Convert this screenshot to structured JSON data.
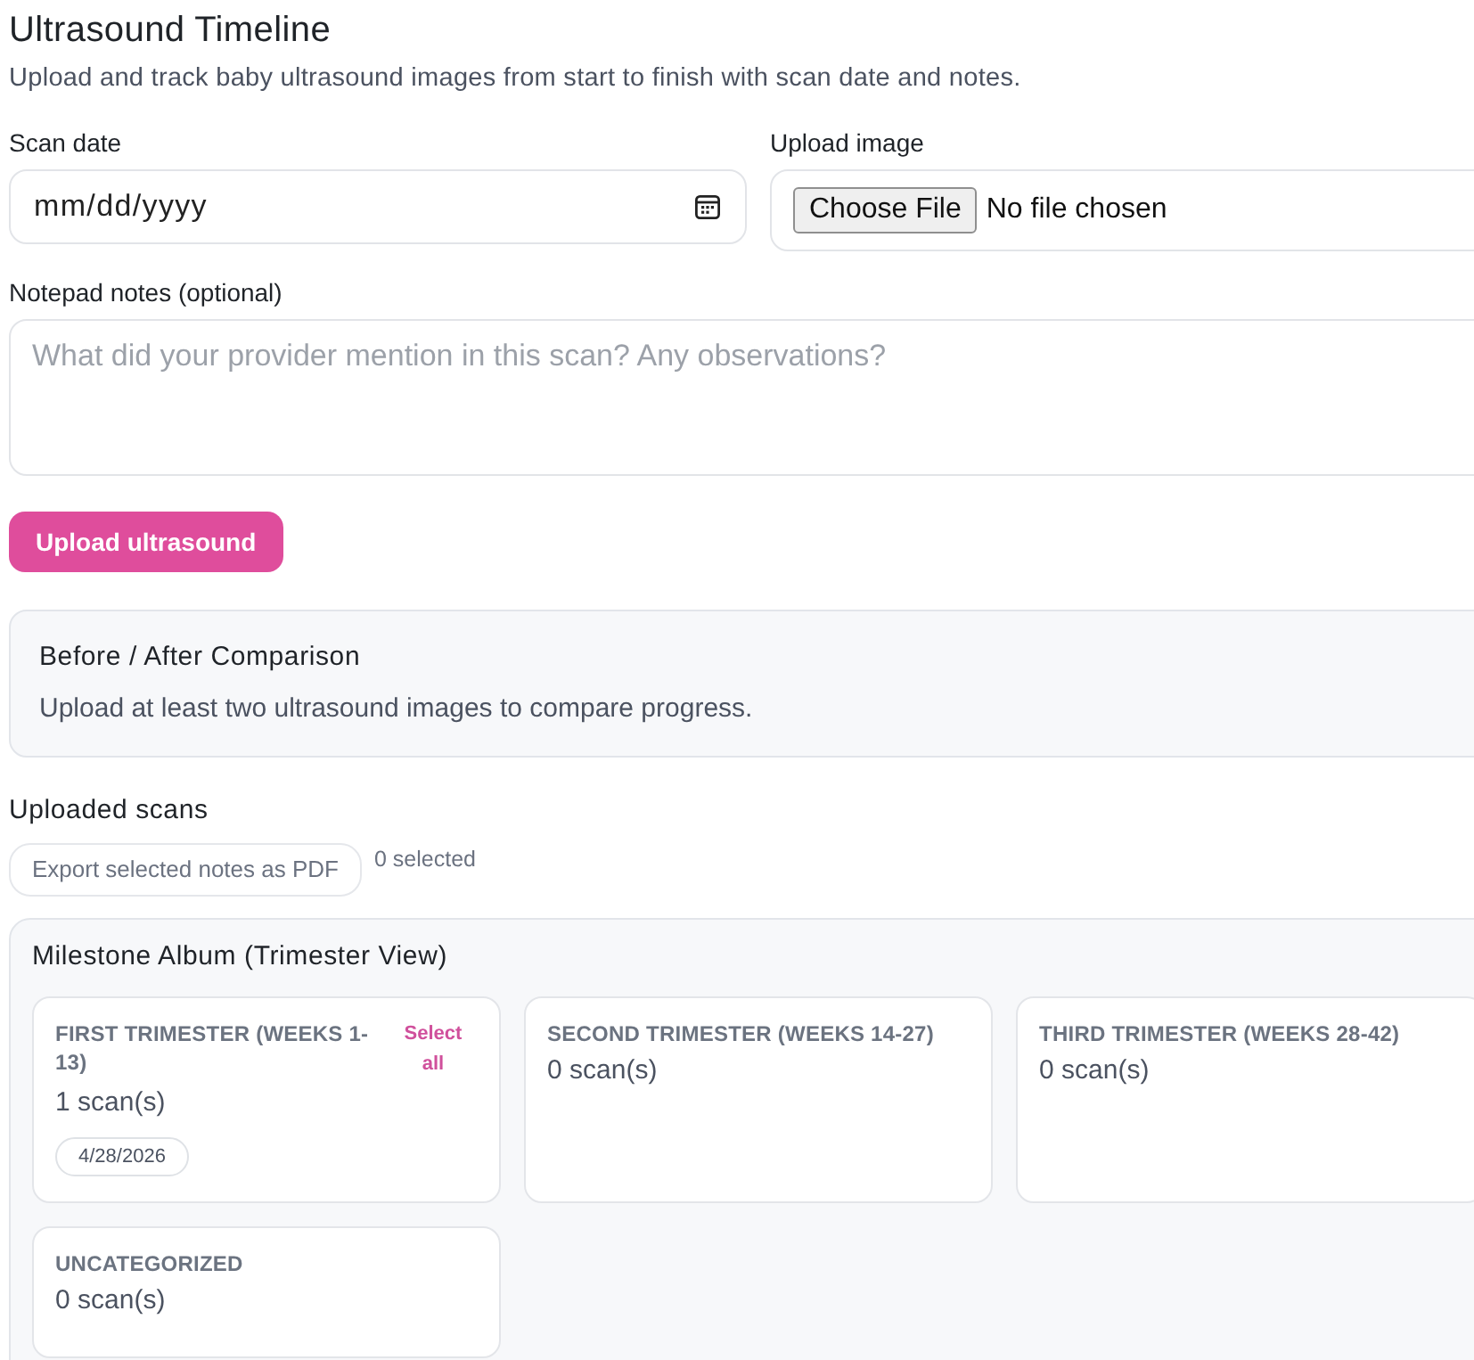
{
  "title": "Ultrasound Timeline",
  "subtitle": "Upload and track baby ultrasound images from start to finish with scan date and notes.",
  "scan_date": {
    "label": "Scan date",
    "placeholder": "mm/dd/yyyy"
  },
  "upload_image": {
    "label": "Upload image",
    "button": "Choose File",
    "status": "No file chosen"
  },
  "notes": {
    "label": "Notepad notes (optional)",
    "placeholder": "What did your provider mention in this scan? Any observations?"
  },
  "upload_button": "Upload ultrasound",
  "comparison": {
    "title": "Before / After Comparison",
    "message": "Upload at least two ultrasound images to compare progress."
  },
  "uploaded_scans": {
    "title": "Uploaded scans",
    "export_button": "Export selected notes as PDF",
    "selected_count": "0 selected"
  },
  "album": {
    "title": "Milestone Album (Trimester View)",
    "groups": [
      {
        "heading": "FIRST TRIMESTER (WEEKS 1-13)",
        "action": "Select all",
        "count": "1 scan(s)",
        "dates": [
          "4/28/2026"
        ]
      },
      {
        "heading": "SECOND TRIMESTER (WEEKS 14-27)",
        "count": "0 scan(s)"
      },
      {
        "heading": "THIRD TRIMESTER (WEEKS 28-42)",
        "count": "0 scan(s)"
      },
      {
        "heading": "UNCATEGORIZED",
        "count": "0 scan(s)"
      }
    ]
  }
}
